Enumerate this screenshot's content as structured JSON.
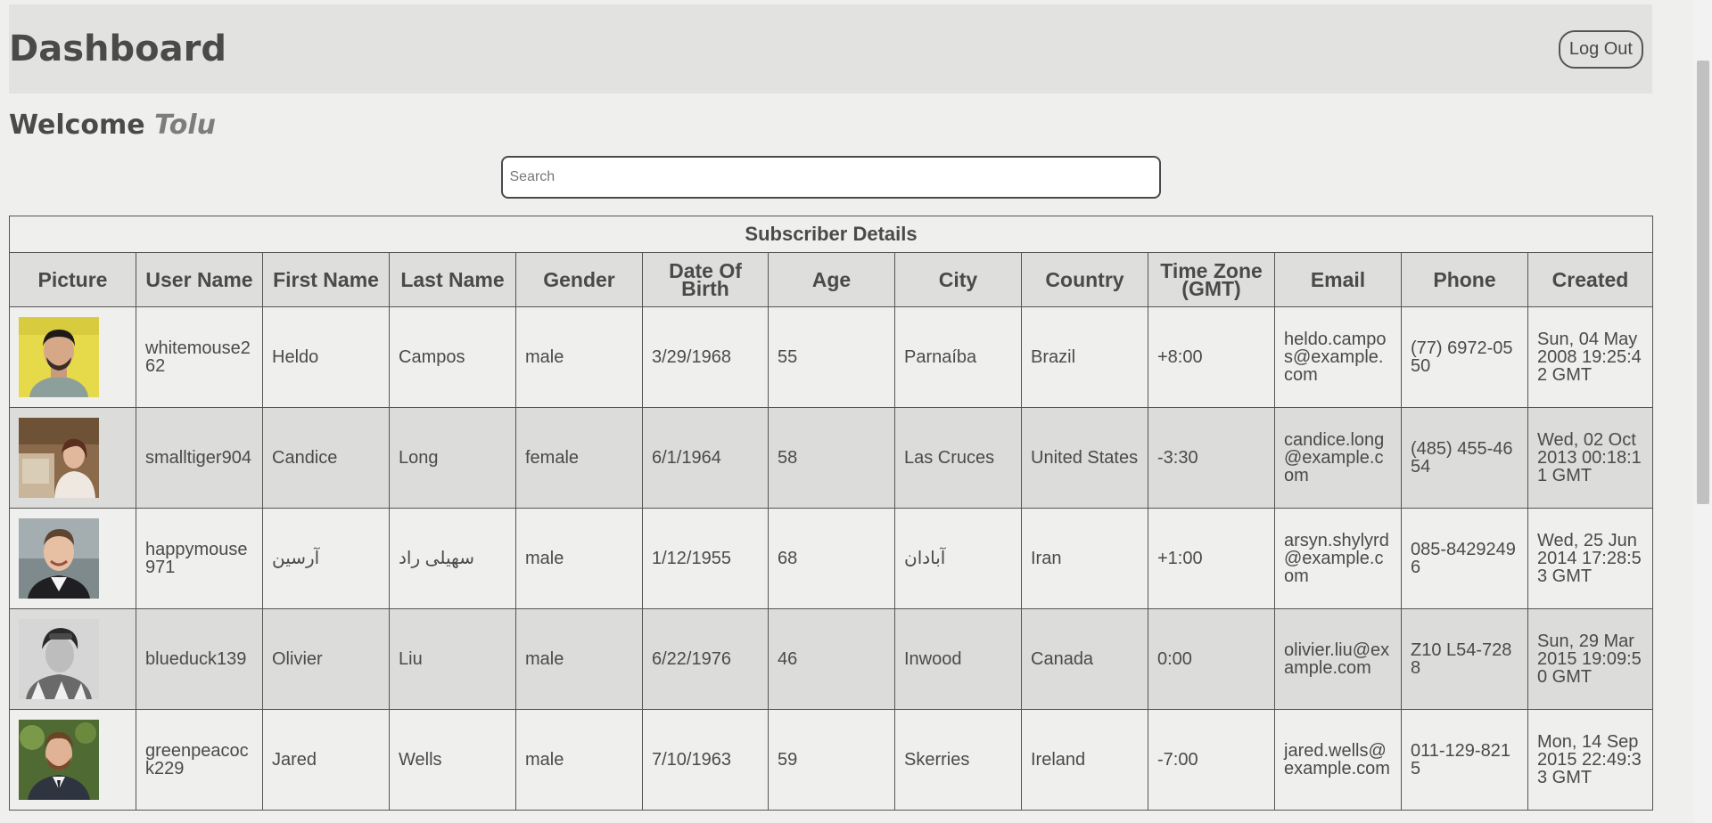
{
  "header": {
    "title": "Dashboard",
    "logout_label": "Log Out"
  },
  "welcome": {
    "prefix": "Welcome",
    "user": "Tolu"
  },
  "search": {
    "placeholder": "Search"
  },
  "table": {
    "caption": "Subscriber Details",
    "headers": [
      "Picture",
      "User Name",
      "First Name",
      "Last Name",
      "Gender",
      "Date Of Birth",
      "Age",
      "City",
      "Country",
      "Time Zone (GMT)",
      "Email",
      "Phone",
      "Created"
    ],
    "rows": [
      {
        "username": "whitemouse262",
        "first": "Heldo",
        "last": "Campos",
        "gender": "male",
        "dob": "3/29/1968",
        "age": "55",
        "city": "Parnaíba",
        "country": "Brazil",
        "tz": "+8:00",
        "email": "heldo.campos@example.com",
        "phone": "(77) 6972-0550",
        "created": "Sun, 04 May 2008 19:25:42 GMT"
      },
      {
        "username": "smalltiger904",
        "first": "Candice",
        "last": "Long",
        "gender": "female",
        "dob": "6/1/1964",
        "age": "58",
        "city": "Las Cruces",
        "country": "United States",
        "tz": "-3:30",
        "email": "candice.long@example.com",
        "phone": "(485) 455-4654",
        "created": "Wed, 02 Oct 2013 00:18:11 GMT"
      },
      {
        "username": "happymouse971",
        "first": "آرسین",
        "last": "سهیلی راد",
        "gender": "male",
        "dob": "1/12/1955",
        "age": "68",
        "city": "آبادان",
        "country": "Iran",
        "tz": "+1:00",
        "email": "arsyn.shylyrd@example.com",
        "phone": "085-84292496",
        "created": "Wed, 25 Jun 2014 17:28:53 GMT"
      },
      {
        "username": "blueduck139",
        "first": "Olivier",
        "last": "Liu",
        "gender": "male",
        "dob": "6/22/1976",
        "age": "46",
        "city": "Inwood",
        "country": "Canada",
        "tz": "0:00",
        "email": "olivier.liu@example.com",
        "phone": "Z10 L54-7288",
        "created": "Sun, 29 Mar 2015 19:09:50 GMT"
      },
      {
        "username": "greenpeacock229",
        "first": "Jared",
        "last": "Wells",
        "gender": "male",
        "dob": "7/10/1963",
        "age": "59",
        "city": "Skerries",
        "country": "Ireland",
        "tz": "-7:00",
        "email": "jared.wells@example.com",
        "phone": "011-129-8215",
        "created": "Mon, 14 Sep 2015 22:49:33 GMT"
      }
    ]
  }
}
